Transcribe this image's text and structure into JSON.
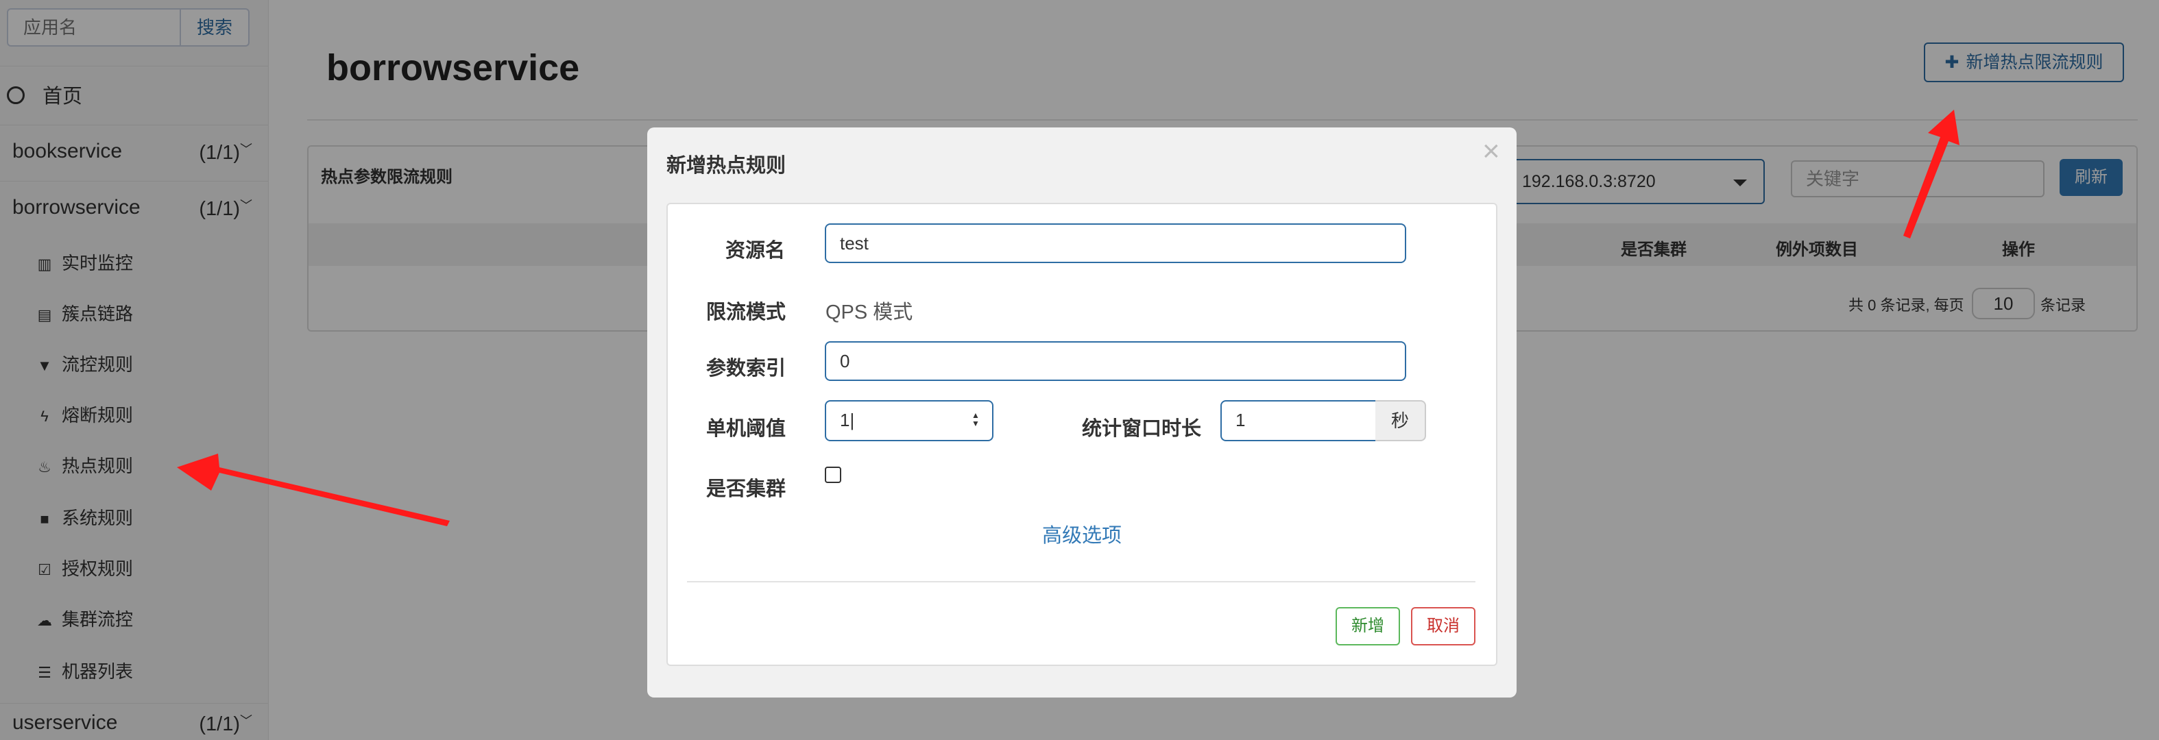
{
  "sidebar": {
    "search": {
      "placeholder": "应用名",
      "button": "搜索"
    },
    "home": "首页",
    "apps": [
      {
        "name": "bookservice",
        "count": "(1/1)"
      },
      {
        "name": "borrowservice",
        "count": "(1/1)"
      },
      {
        "name": "userservice",
        "count": "(1/1)"
      }
    ],
    "menu": [
      {
        "label": "实时监控",
        "icon": "bar-chart-icon"
      },
      {
        "label": "簇点链路",
        "icon": "list-doc-icon"
      },
      {
        "label": "流控规则",
        "icon": "filter-icon"
      },
      {
        "label": "熔断规则",
        "icon": "bolt-icon"
      },
      {
        "label": "热点规则",
        "icon": "fire-icon"
      },
      {
        "label": "系统规则",
        "icon": "lock-icon"
      },
      {
        "label": "授权规则",
        "icon": "check-square-icon"
      },
      {
        "label": "集群流控",
        "icon": "cloud-icon"
      },
      {
        "label": "机器列表",
        "icon": "list-icon"
      }
    ]
  },
  "main": {
    "title": "borrowservice",
    "add_button": "新增热点限流规则",
    "panel_title": "热点参数限流规则",
    "machine": "192.168.0.3:8720",
    "keyword_placeholder": "关键字",
    "refresh": "刷新",
    "columns": [
      "是否集群",
      "例外项数目",
      "操作"
    ],
    "pager_prefix": "共 0 条记录, 每页",
    "page_size": "10",
    "pager_suffix": "条记录"
  },
  "modal": {
    "title": "新增热点规则",
    "close": "×",
    "resource_label": "资源名",
    "resource_value": "test",
    "mode_label": "限流模式",
    "mode_value": "QPS 模式",
    "index_label": "参数索引",
    "index_value": "0",
    "threshold_label": "单机阈值",
    "threshold_value": "1",
    "window_label": "统计窗口时长",
    "window_value": "1",
    "window_unit": "秒",
    "cluster_label": "是否集群",
    "cluster_checked": false,
    "advanced": "高级选项",
    "confirm": "新增",
    "cancel": "取消"
  },
  "colors": {
    "primary": "#337ab7",
    "overlay": "rgba(0,0,0,0.4)",
    "arrow": "#ff1a1a",
    "confirm": "#5cb85c",
    "cancel": "#d9534f"
  }
}
